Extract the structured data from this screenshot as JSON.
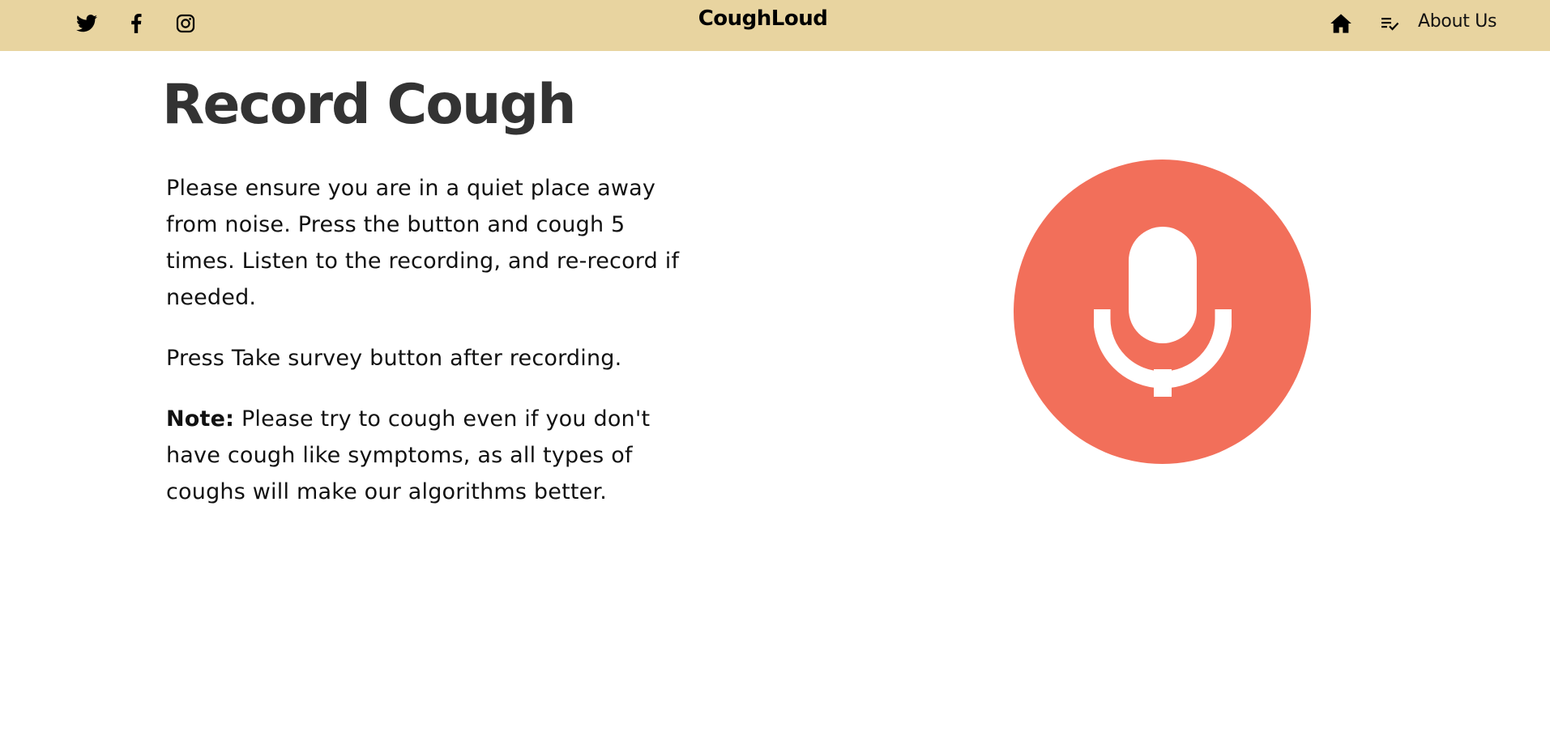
{
  "brand": {
    "title": "CoughLoud",
    "accent_bg": "#e8d4a0"
  },
  "social": [
    {
      "icon": "twitter-icon"
    },
    {
      "icon": "facebook-icon"
    },
    {
      "icon": "instagram-icon"
    }
  ],
  "nav": {
    "home_icon": "home-icon",
    "list_icon": "list-check-icon",
    "about_label": "About Us"
  },
  "main": {
    "title": "Record Cough",
    "paragraph1": "Please ensure you are in a quiet place away from noise. Press the button and cough 5 times. Listen to the recording, and re-record if needed.",
    "paragraph2": "Press Take survey button after recording.",
    "note_label": "Note:",
    "note_text": " Please try to cough even if you don't have cough like symptoms, as all types of coughs will make our algorithms better."
  },
  "record": {
    "icon": "microphone-icon",
    "color": "#f26f5a"
  }
}
